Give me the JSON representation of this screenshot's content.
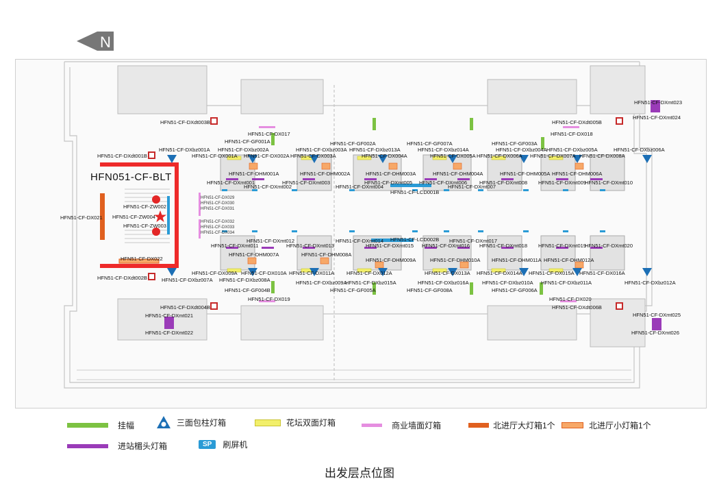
{
  "north_label": "N",
  "highlight_area_label": "HFN051-CF-BLT",
  "caption": "出发层点位图",
  "colors": {
    "banner": "#7cc242",
    "tri_box": "#1c6fb5",
    "planter": "#f2ef6a",
    "wall": "#e58ee0",
    "big_box": "#e0601f",
    "small_box": "#f7a868",
    "lintel": "#9a3bb8",
    "sp": "#2a9bd6",
    "highlight": "#ee2a2a"
  },
  "legend": {
    "banner": "挂幅",
    "tri_box": "三面包柱灯箱",
    "planter": "花坛双面灯箱",
    "wall": "商业墙面灯箱",
    "big_box": "北进厅大灯箱1个",
    "small_box": "北进厅小灯箱1个",
    "lintel": "进站楣头灯箱",
    "sp_icon": "SP",
    "sp": "刷屏机"
  },
  "labels": {
    "dxt003b": "HFN51-CF-DXdt003B",
    "dx017": "HFN51-CF-DX017",
    "dxt005b": "HFN51-CF-DXdt005B",
    "dx018": "HFN51-CF-DX018",
    "dxmt023": "HFN51-CF-DXmt023",
    "dxmt024": "HFN51-CF-DXmt024",
    "gf001a": "HFN51-CF-GF001A",
    "gf002a": "HFN51-CF-GF002A",
    "gf007a": "HFN51-CF-GF007A",
    "gf003a": "HFN51-CF-GF003A",
    "dxbz001a": "HFN51-CF-DXbz001A",
    "dxbz002a": "HFN51-CF-DXbz002A",
    "dxbz003a": "HFN51-CF-DXbz003A",
    "dxbz013a": "HFN51-CF-DXbz013A",
    "dxbz014a": "HFN51-CF-DXbz014A",
    "dxbz004a": "HFN51-CF-DXbz004A",
    "dxbz005a": "HFN51-CF-DXbz005A",
    "dxbz006a": "HFN51-CF-DXbz006A",
    "dxt001b": "HFN51-CF-DXdt001B",
    "dx001a": "HFN51-CF-DX001A",
    "dx002a": "HFN51-CF-DX002A",
    "dx003a": "HFN51-CF-DX003A",
    "dx004a": "HFN51-CF-DX004A",
    "dx005a": "HFN51-CF-DX005A",
    "dx006a": "HFN51-CF-DX006A",
    "dx007a": "HFN51-CF-DX007A",
    "dx008a": "HFN51-CF-DX008A",
    "dhm001a": "HFN51-CF-DHM001A",
    "dhm002a": "HFN51-CF-DHM002A",
    "dhm003a": "HFN51-CF-DHM003A",
    "dhm004a": "HFN51-CF-DHM004A",
    "dhm005a": "HFN51-CF-DHM005A",
    "dhm006a": "HFN51-CF-DHM006A",
    "dxmt001": "HFN51-CF-DXmt001",
    "dxmt002": "HFN51-CF-DXmt002",
    "dxmt003": "HFN51-CF-DXmt003",
    "dxmt004": "HFN51-CF-DXmt004",
    "dxmt005": "HFN51-CF-DXmt005",
    "dxmt006": "HFN51-CF-DXmt006",
    "dxmt007": "HFN51-CF-DXmt007",
    "dxmt008": "HFN51-CF-DXmt008",
    "dxmt009": "HFN51-CF-DXmt009",
    "dxmt010": "HFN51-CF-DXmt010",
    "dx021": "HFN51-CF-DX021",
    "zw002": "HFN51-CF-ZW002",
    "zw004": "HFN51-CF-ZW004",
    "zw003": "HFN51-CF-ZW003",
    "dx022": "HFN51-CF-DX022",
    "dx029": "HFN51-CF-DX029",
    "dx030": "HFN51-CF-DX030",
    "dx031": "HFN51-CF-DX031",
    "dx032": "HFN51-CF-DX032",
    "dx033": "HFN51-CF-DX033",
    "dx034": "HFN51-CF-DX034",
    "lcd001": "HFN51-CF-LCD001B",
    "dxmt011": "HFN51-CF-DXmt011",
    "dxmt012": "HFN51-CF-DXmt012",
    "dxmt013": "HFN51-CF-DXmt013",
    "dxmt014": "HFN51-CF-DXmt014",
    "dxmt015": "HFN51-CF-DXmt015",
    "dxmt016": "HFN51-CF-DXmt016",
    "dxmt017": "HFN51-CF-DXmt017",
    "dxmt018": "HFN51-CF-DXmt018",
    "dxmt019": "HFN51-CF-DXmt019",
    "dxmt020": "HFN51-CF-DXmt020",
    "lcd002b": "HFN51-CF-LCD002B",
    "dhm007a": "HFN51-CF-DHM007A",
    "dhm008a": "HFN51-CF-DHM008A",
    "dhm009a": "HFN51-CF-DHM009A",
    "dhm010a": "HFN51-CF-DHM010A",
    "dhm011a": "HFN51-CF-DHM011A",
    "dhm012a": "HFN51-CF-DHM012A",
    "dx009a": "HFN51-CF-DX009A",
    "dx010a": "HFN51-CF-DX010A",
    "dx011a": "HFN51-CF-DX011A",
    "dx012a": "HFN51-CF-DX012A",
    "dx013a": "HFN51-CF-DX013A",
    "dx014a": "HFN51-CF-DX014A",
    "dx015a": "HFN51-CF-DX015A",
    "dx016a": "HFN51-CF-DX016A",
    "dxt002b": "HFN51-CF-DXdt002B",
    "dxbz007a": "HFN51-CF-DXbz007A",
    "dxbz008a": "HFN51-CF-DXbz008A",
    "dxbz009a": "HFN51-CF-DXbz009A",
    "dxbz015a": "HFN51-CF-DXbz015A",
    "dxbz016a": "HFN51-CF-DXbz016A",
    "dxbz010a": "HFN51-CF-DXbz010A",
    "dxbz011a": "HFN51-CF-DXbz011A",
    "dxbz012a": "HFN51-CF-DXbz012A",
    "gf004b": "HFN51-CF-GF004B",
    "gf005a": "HFN51-CF-GF005A",
    "gf008a": "HFN51-CF-GF008A",
    "gf006a": "HFN51-CF-GF006A",
    "dx019": "HFN51-CF-DX019",
    "dx020": "HFN51-CF-DX020",
    "dxt004b": "HFN51-CF-DXdt004B",
    "dxt006b": "HFN51-CF-DXdt006B",
    "dxmt021": "HFN51-CF-DXmt021",
    "dxmt022": "HFN51-CF-DXmt022",
    "dxmt025": "HFN51-CF-DXmt025",
    "dxmt026": "HFN51-CF-DXmt026"
  }
}
